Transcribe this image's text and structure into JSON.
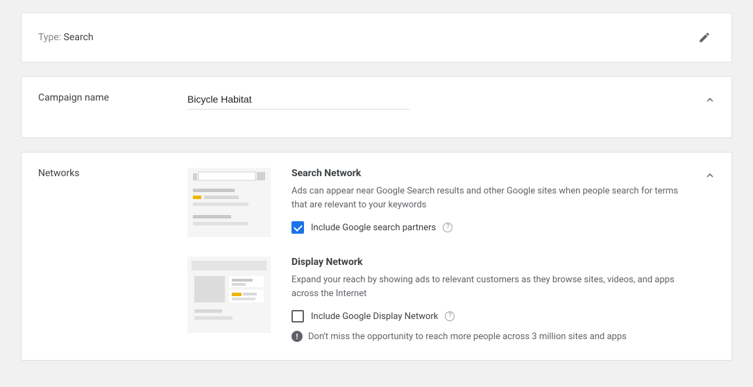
{
  "type_card": {
    "label_prefix": "Type: ",
    "value": "Search"
  },
  "campaign_name": {
    "label": "Campaign name",
    "value": "Bicycle Habitat"
  },
  "networks": {
    "label": "Networks",
    "search": {
      "title": "Search Network",
      "desc": "Ads can appear near Google Search results and other Google sites when people search for terms that are relevant to your keywords",
      "checkbox_label": "Include Google search partners",
      "checked": true
    },
    "display": {
      "title": "Display Network",
      "desc": "Expand your reach by showing ads to relevant customers as they browse sites, videos, and apps across the Internet",
      "checkbox_label": "Include Google Display Network",
      "checked": false,
      "note": "Don't miss the opportunity to reach more people across 3 million sites and apps"
    }
  }
}
